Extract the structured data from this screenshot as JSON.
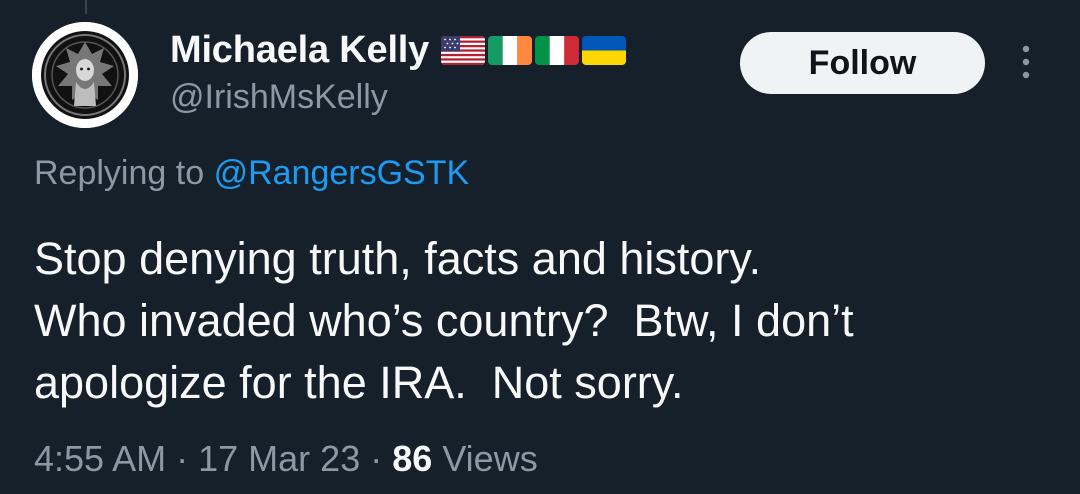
{
  "author": {
    "display_name": "Michaela Kelly",
    "handle": "@IrishMsKelly",
    "flags": [
      "us-flag-icon",
      "ireland-flag-icon",
      "italy-flag-icon",
      "ukraine-flag-icon"
    ]
  },
  "actions": {
    "follow_label": "Follow",
    "more_icon": "vertical-ellipsis-icon"
  },
  "reply": {
    "prefix": "Replying to",
    "target": "@RangersGSTK"
  },
  "tweet": {
    "lines": [
      "Stop denying truth, facts and history.",
      "Who invaded who’s country?  Btw, I don’t",
      "apologize for the IRA.  Not sorry."
    ]
  },
  "meta": {
    "time": "4:55 AM",
    "separator": "·",
    "date": "17 Mar 23",
    "views_count": "86",
    "views_label": "Views"
  },
  "colors": {
    "background": "#15202b",
    "text_primary": "#f7f9f9",
    "text_secondary": "#8b98a5",
    "link": "#1d9bf0",
    "follow_bg": "#eff3f4"
  }
}
